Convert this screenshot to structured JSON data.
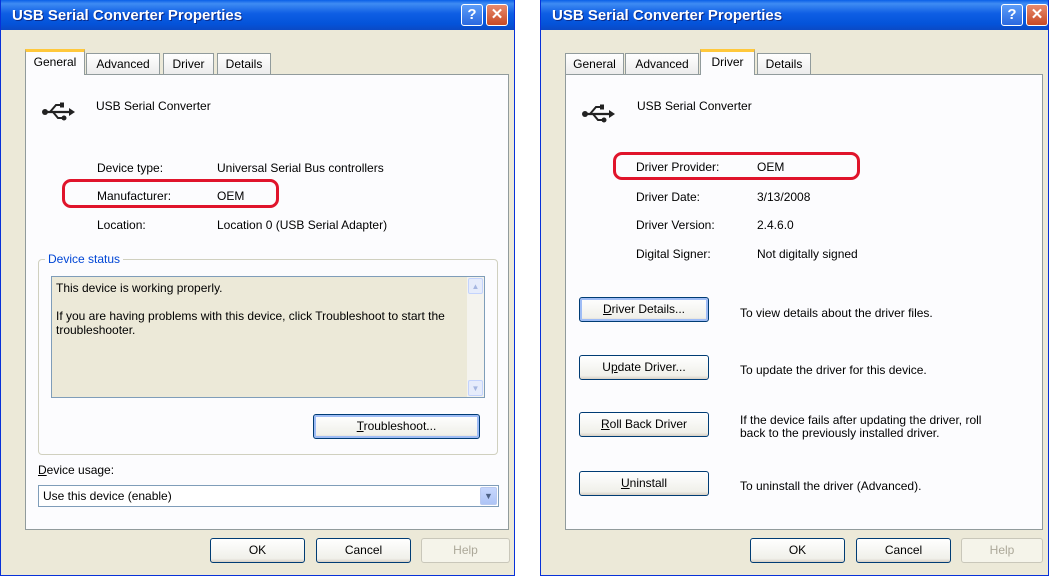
{
  "left_window": {
    "title": "USB Serial Converter Properties",
    "help_glyph": "?",
    "close_glyph": "✕",
    "tabs": [
      "General",
      "Advanced",
      "Driver",
      "Details"
    ],
    "active_tab": "General",
    "device_name": "USB Serial Converter",
    "device_type_label": "Device type:",
    "device_type_value": "Universal Serial Bus controllers",
    "manufacturer_label": "Manufacturer:",
    "manufacturer_value": "OEM",
    "location_label": "Location:",
    "location_value": "Location 0 (USB Serial Adapter)",
    "device_status_legend": "Device status",
    "status_line1": "This device is working properly.",
    "status_line2": "If you are having problems with this device, click Troubleshoot to start the troubleshooter.",
    "troubleshoot_button_key": "T",
    "troubleshoot_button_rest": "roubleshoot...",
    "device_usage_label_key": "D",
    "device_usage_label_rest": "evice usage:",
    "device_usage_value": "Use this device (enable)",
    "ok_label": "OK",
    "cancel_label": "Cancel",
    "help_label": "Help"
  },
  "right_window": {
    "title": "USB Serial Converter Properties",
    "help_glyph": "?",
    "close_glyph": "✕",
    "tabs": [
      "General",
      "Advanced",
      "Driver",
      "Details"
    ],
    "active_tab": "Driver",
    "device_name": "USB Serial Converter",
    "driver_provider_label": "Driver Provider:",
    "driver_provider_value": "OEM",
    "driver_date_label": "Driver Date:",
    "driver_date_value": "3/13/2008",
    "driver_version_label": "Driver Version:",
    "driver_version_value": "2.4.6.0",
    "digital_signer_label": "Digital Signer:",
    "digital_signer_value": "Not digitally signed",
    "driver_details_key": "D",
    "driver_details_rest": "river Details...",
    "driver_details_desc": "To view details about the driver files.",
    "update_driver_pre": "U",
    "update_driver_key": "p",
    "update_driver_rest": "date Driver...",
    "update_driver_desc": "To update the driver for this device.",
    "roll_back_key": "R",
    "roll_back_rest": "oll Back Driver",
    "roll_back_desc_line1": "If the device fails after updating the driver, roll",
    "roll_back_desc_line2": "back to the previously installed driver.",
    "uninstall_key": "U",
    "uninstall_rest": "ninstall",
    "uninstall_desc": "To uninstall the driver (Advanced).",
    "ok_label": "OK",
    "cancel_label": "Cancel",
    "help_label": "Help"
  },
  "colors": {
    "titlebar": "#0453d9",
    "highlight": "#e0142b",
    "active_tab_accent": "#ffc83c",
    "dialog_bg": "#ece9d8"
  },
  "icons": {
    "device": "usb-icon",
    "dropdown": "chevron-down-icon"
  }
}
